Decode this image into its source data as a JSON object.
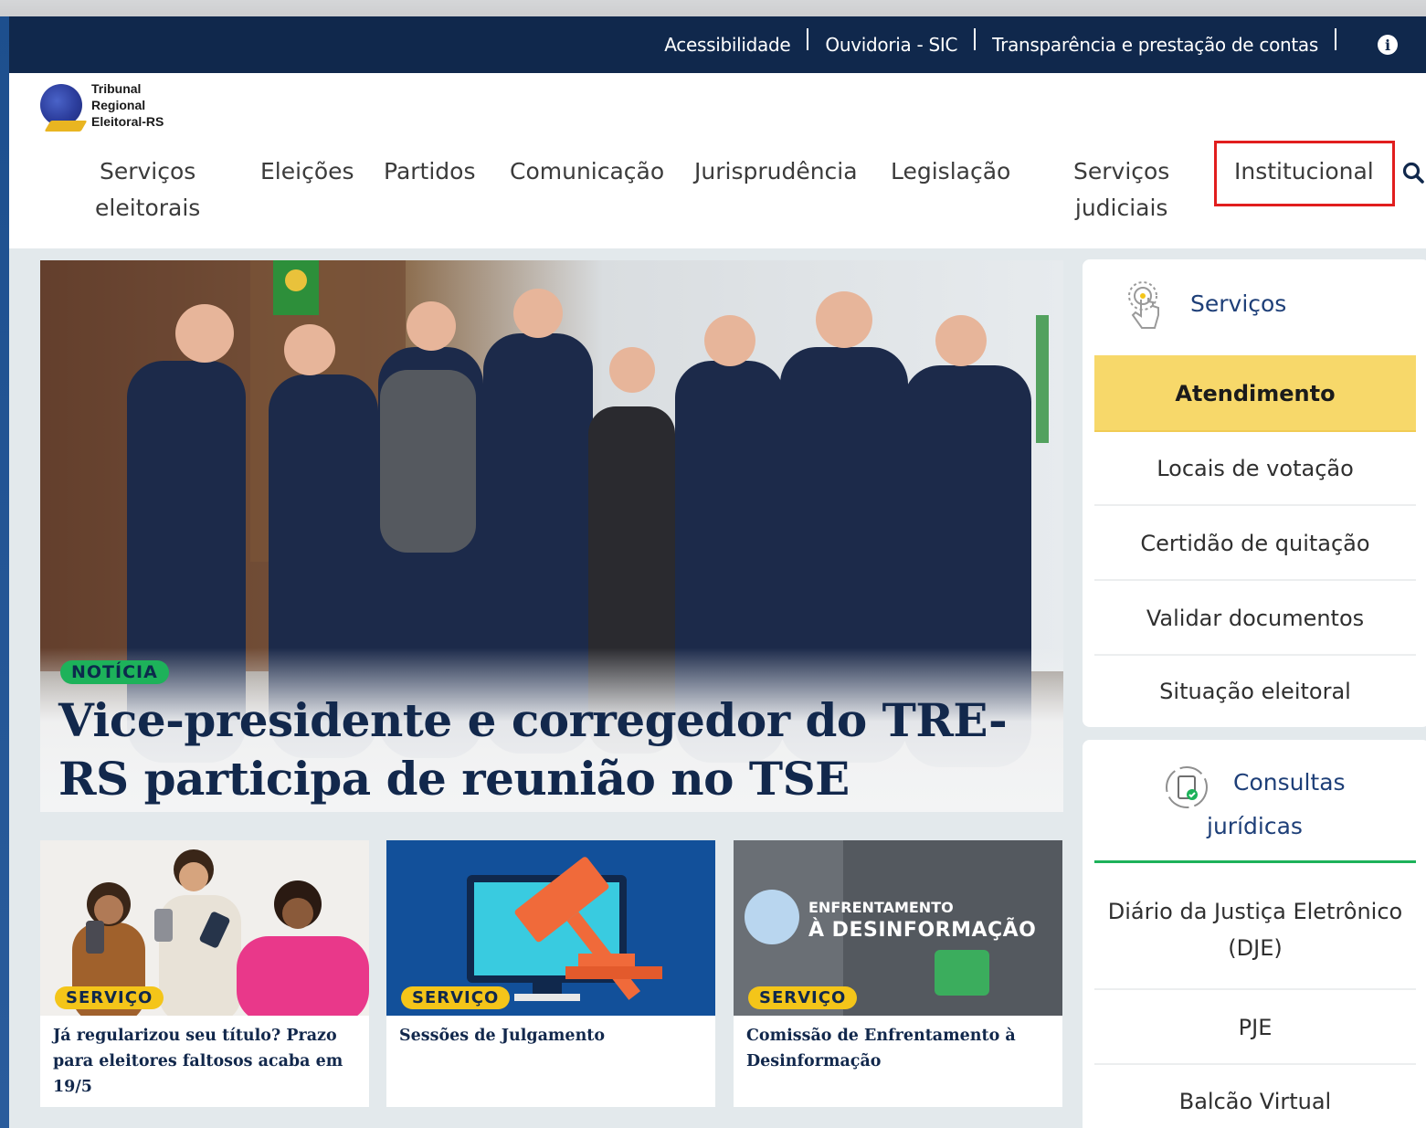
{
  "topbar": {
    "links": [
      "Acessibilidade",
      "Ouvidoria - SIC",
      "Transparência e prestação de contas"
    ],
    "info_icon": "i"
  },
  "logo": {
    "line1": "Tribunal",
    "line2": "Regional",
    "line3": "Eleitoral-RS"
  },
  "nav": {
    "items": [
      {
        "line1": "Serviços",
        "line2": "eleitorais"
      },
      {
        "line1": "Eleições"
      },
      {
        "line1": "Partidos"
      },
      {
        "line1": "Comunicação"
      },
      {
        "line1": "Jurisprudência"
      },
      {
        "line1": "Legislação"
      },
      {
        "line1": "Serviços",
        "line2": "judiciais"
      },
      {
        "line1": "Institucional"
      }
    ],
    "highlighted": "Institucional",
    "highlight_color": "#e11e1e"
  },
  "hero": {
    "badge": "NOTÍCIA",
    "title": "Vice-presidente e corregedor do TRE-RS participa de reunião no TSE"
  },
  "cards": [
    {
      "badge": "SERVIÇO",
      "title": "Já regularizou seu título? Prazo para eleitores faltosos acaba em 19/5"
    },
    {
      "badge": "SERVIÇO",
      "title": "Sessões de Julgamento"
    },
    {
      "badge": "SERVIÇO",
      "title": "Comissão de Enfrentamento à Desinformação",
      "image_line1": "ENFRENTAMENTO",
      "image_line2": "À DESINFORMAÇÃO"
    }
  ],
  "sidebar_services": {
    "heading": "Serviços",
    "items": [
      "Atendimento",
      "Locais de votação",
      "Certidão de quitação",
      "Validar documentos",
      "Situação eleitoral"
    ]
  },
  "sidebar_consultas": {
    "heading_line1": "Consultas",
    "heading_line2": "jurídicas",
    "items": [
      "Diário da Justiça Eletrônico (DJE)",
      "PJE",
      "Balcão Virtual"
    ]
  },
  "colors": {
    "topbar": "#10284c",
    "accent_yellow": "#f4c519",
    "notice_green": "#1db25a",
    "title_navy": "#12284c"
  }
}
